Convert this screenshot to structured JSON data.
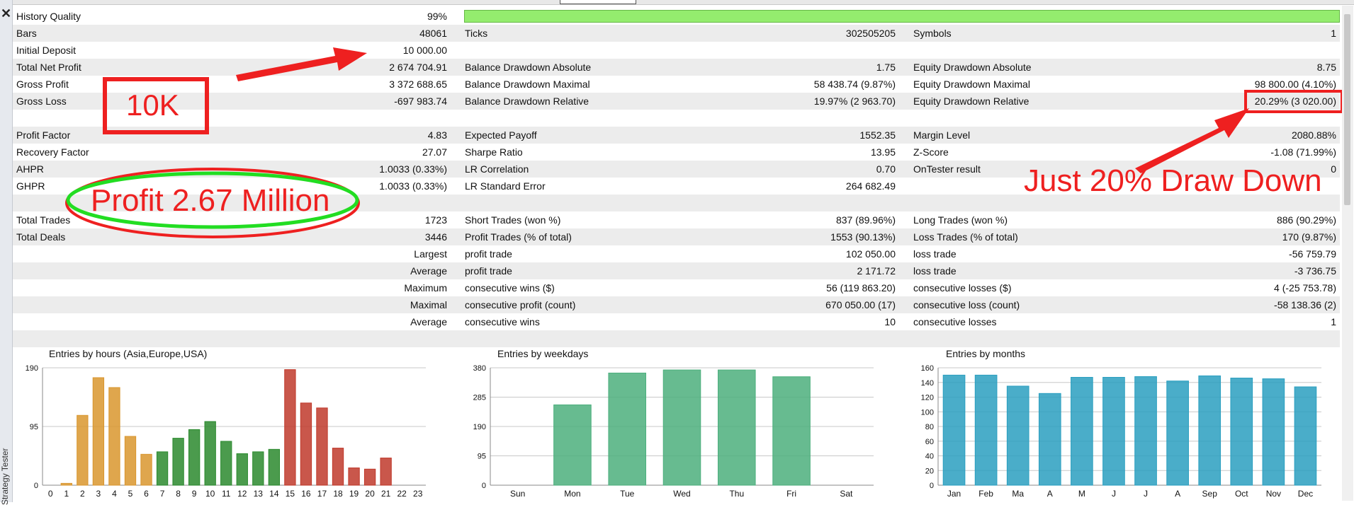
{
  "window": {
    "close_glyph": "✕",
    "panel_label": "Strategy Tester"
  },
  "stats_rows": [
    {
      "l1": "History Quality",
      "v1": "99%",
      "l2": "",
      "v2": "",
      "l3": "",
      "v3": "",
      "quality_bar_fraction": 0.99
    },
    {
      "l1": "Bars",
      "v1": "48061",
      "l2": "Ticks",
      "v2": "302505205",
      "l3": "Symbols",
      "v3": "1"
    },
    {
      "l1": "Initial Deposit",
      "v1": "10 000.00",
      "l2": "",
      "v2": "",
      "l3": "",
      "v3": ""
    },
    {
      "l1": "Total Net Profit",
      "v1": "2 674 704.91",
      "l2": "Balance Drawdown Absolute",
      "v2": "1.75",
      "l3": "Equity Drawdown Absolute",
      "v3": "8.75"
    },
    {
      "l1": "Gross Profit",
      "v1": "3 372 688.65",
      "l2": "Balance Drawdown Maximal",
      "v2": "58 438.74 (9.87%)",
      "l3": "Equity Drawdown Maximal",
      "v3": "98 800.00 (4.10%)"
    },
    {
      "l1": "Gross Loss",
      "v1": "-697 983.74",
      "l2": "Balance Drawdown Relative",
      "v2": "19.97% (2 963.70)",
      "l3": "Equity Drawdown Relative",
      "v3": "20.29% (3 020.00)"
    },
    {
      "l1": "",
      "v1": "",
      "l2": "",
      "v2": "",
      "l3": "",
      "v3": ""
    },
    {
      "l1": "Profit Factor",
      "v1": "4.83",
      "l2": "Expected Payoff",
      "v2": "1552.35",
      "l3": "Margin Level",
      "v3": "2080.88%"
    },
    {
      "l1": "Recovery Factor",
      "v1": "27.07",
      "l2": "Sharpe Ratio",
      "v2": "13.95",
      "l3": "Z-Score",
      "v3": "-1.08 (71.99%)"
    },
    {
      "l1": "AHPR",
      "v1": "1.0033 (0.33%)",
      "l2": "LR Correlation",
      "v2": "0.70",
      "l3": "OnTester result",
      "v3": "0"
    },
    {
      "l1": "GHPR",
      "v1": "1.0033 (0.33%)",
      "l2": "LR Standard Error",
      "v2": "264 682.49",
      "l3": "",
      "v3": ""
    },
    {
      "l1": "",
      "v1": "",
      "l2": "",
      "v2": "",
      "l3": "",
      "v3": ""
    },
    {
      "l1": "Total Trades",
      "v1": "1723",
      "l2": "Short Trades (won %)",
      "v2": "837 (89.96%)",
      "l3": "Long Trades (won %)",
      "v3": "886 (90.29%)"
    },
    {
      "l1": "Total Deals",
      "v1": "3446",
      "l2": "Profit Trades (% of total)",
      "v2": "1553 (90.13%)",
      "l3": "Loss Trades (% of total)",
      "v3": "170 (9.87%)"
    },
    {
      "lr": "Largest",
      "l2": "profit trade",
      "v2": "102 050.00",
      "l3": "loss trade",
      "v3": "-56 759.79"
    },
    {
      "lr": "Average",
      "l2": "profit trade",
      "v2": "2 171.72",
      "l3": "loss trade",
      "v3": "-3 736.75"
    },
    {
      "lr": "Maximum",
      "l2": "consecutive wins ($)",
      "v2": "56 (119 863.20)",
      "l3": "consecutive losses ($)",
      "v3": "4 (-25 753.78)"
    },
    {
      "lr": "Maximal",
      "l2": "consecutive profit (count)",
      "v2": "670 050.00 (17)",
      "l3": "consecutive loss (count)",
      "v3": "-58 138.36 (2)"
    },
    {
      "lr": "Average",
      "l2": "consecutive wins",
      "v2": "10",
      "l3": "consecutive losses",
      "v3": "1"
    },
    {
      "l1": "",
      "v1": "",
      "l2": "",
      "v2": "",
      "l3": "",
      "v3": ""
    }
  ],
  "annotations": {
    "deposit_box_text": "10K",
    "profit_ellipse_text": "Profit  2.67 Million",
    "drawdown_text": "Just 20% Draw Down",
    "color": "#ee2020",
    "ellipse_inner_color": "#22dd22"
  },
  "chart_data": [
    {
      "type": "bar",
      "title": "Entries by hours (Asia,Europe,USA)",
      "categories": [
        "0",
        "1",
        "2",
        "3",
        "4",
        "5",
        "6",
        "7",
        "8",
        "9",
        "10",
        "11",
        "12",
        "13",
        "14",
        "15",
        "16",
        "17",
        "18",
        "19",
        "20",
        "21",
        "22",
        "23"
      ],
      "values": [
        0,
        3,
        113,
        174,
        158,
        79,
        50,
        54,
        76,
        90,
        103,
        71,
        51,
        54,
        58,
        187,
        133,
        125,
        60,
        28,
        26,
        44,
        0,
        0
      ],
      "yticks": [
        "0",
        "95",
        "190"
      ],
      "ylim": [
        0,
        190
      ],
      "color_mode": "session-gradient"
    },
    {
      "type": "bar",
      "title": "Entries by weekdays",
      "categories": [
        "Sun",
        "Mon",
        "Tue",
        "Wed",
        "Thu",
        "Fri",
        "Sat"
      ],
      "values": [
        0,
        260,
        363,
        373,
        373,
        351,
        0
      ],
      "yticks": [
        "0",
        "95",
        "190",
        "285",
        "380"
      ],
      "ylim": [
        0,
        380
      ],
      "color": "#4caf7d"
    },
    {
      "type": "bar",
      "title": "Entries by months",
      "categories": [
        "Jan",
        "Feb",
        "Mar",
        "Apr",
        "May",
        "Jun",
        "Jul",
        "Aug",
        "Sep",
        "Oct",
        "Nov",
        "Dec"
      ],
      "visible_categories": [
        "Jan",
        "Feb",
        "Ma",
        "A",
        "M",
        "J",
        "J",
        "A",
        "Sep",
        "Oct",
        "Nov",
        "Dec"
      ],
      "values": [
        150,
        150,
        135,
        125,
        147,
        147,
        148,
        142,
        149,
        146,
        145,
        134
      ],
      "yticks": [
        "0",
        "20",
        "40",
        "60",
        "80",
        "100",
        "120",
        "140",
        "160"
      ],
      "ylim": [
        0,
        160
      ],
      "color": "#2a9fc0"
    }
  ]
}
